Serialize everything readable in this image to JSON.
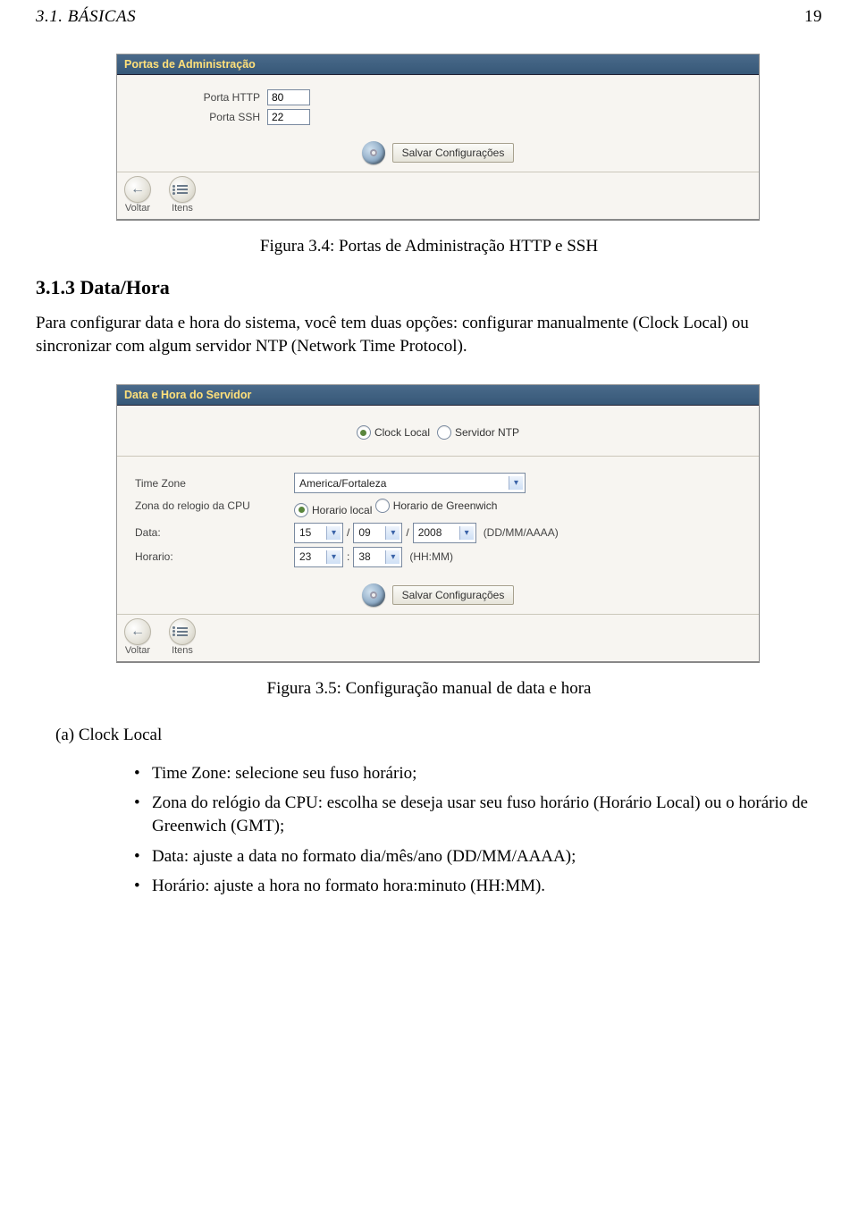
{
  "header": {
    "left": "3.1.  BÁSICAS",
    "right": "19"
  },
  "fig1": {
    "panel_title": "Portas de Administração",
    "http_label": "Porta HTTP",
    "http_value": "80",
    "ssh_label": "Porta SSH",
    "ssh_value": "22",
    "save_label": "Salvar Configurações",
    "back_label": "Voltar",
    "items_label": "Itens",
    "caption": "Figura 3.4: Portas de Administração HTTP e SSH"
  },
  "section": {
    "heading": "3.1.3    Data/Hora",
    "paragraph": "Para configurar data e hora do sistema, você tem duas opções: configurar manualmente (Clock Local) ou sincronizar com algum servidor NTP (Network Time Protocol)."
  },
  "fig2": {
    "panel_title": "Data e Hora do Servidor",
    "radio_local": "Clock Local",
    "radio_ntp": "Servidor NTP",
    "tz_label": "Time Zone",
    "tz_value": "America/Fortaleza",
    "cpuzone_label": "Zona do relogio da CPU",
    "cpuzone_opt1": "Horario local",
    "cpuzone_opt2": "Horario de Greenwich",
    "date_label": "Data:",
    "date_day": "15",
    "date_month": "09",
    "date_year": "2008",
    "date_hint": "(DD/MM/AAAA)",
    "time_label": "Horario:",
    "time_hour": "23",
    "time_min": "38",
    "time_hint": "(HH:MM)",
    "save_label": "Salvar Configurações",
    "back_label": "Voltar",
    "items_label": "Itens",
    "caption": "Figura 3.5: Configuração manual de data e hora"
  },
  "list": {
    "a_label": "(a) Clock Local",
    "items": [
      "Time Zone: selecione seu fuso horário;",
      "Zona do relógio da CPU: escolha se deseja usar seu fuso horário (Horário Local) ou o horário de Greenwich (GMT);",
      "Data: ajuste a data no formato dia/mês/ano (DD/MM/AAAA);",
      "Horário: ajuste a hora no formato hora:minuto (HH:MM)."
    ]
  }
}
